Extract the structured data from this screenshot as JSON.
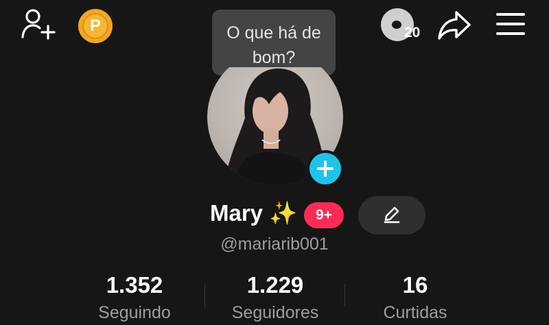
{
  "tooltip": {
    "text": "O que há de bom?"
  },
  "header": {
    "coin_letter": "P",
    "views_count": "20"
  },
  "profile": {
    "name": "Mary ✨",
    "badge": "9+",
    "handle": "@mariarib001"
  },
  "stats": [
    {
      "value": "1.352",
      "label": "Seguindo"
    },
    {
      "value": "1.229",
      "label": "Seguidores"
    },
    {
      "value": "16",
      "label": "Curtidas"
    }
  ],
  "colors": {
    "background": "#161616",
    "accent_blue": "#20c3e8",
    "badge_red": "#fe2c55",
    "coin_gold": "#f5a524"
  }
}
